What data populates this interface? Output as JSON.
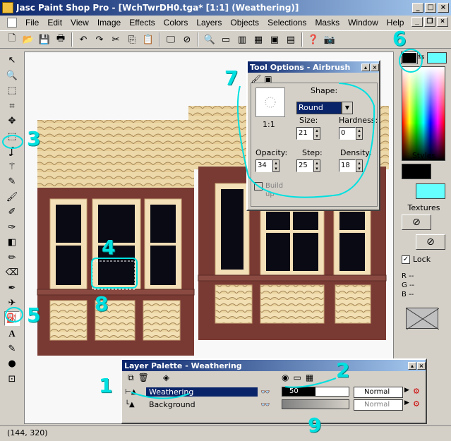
{
  "window": {
    "title": "Jasc Paint Shop Pro - [WchTwrDH0.tga* [1:1] (Weathering)]",
    "min": "_",
    "max": "□",
    "close": "×"
  },
  "menu": [
    "File",
    "Edit",
    "View",
    "Image",
    "Effects",
    "Colors",
    "Layers",
    "Objects",
    "Selections",
    "Masks",
    "Window",
    "Help"
  ],
  "toolbar_icons": [
    "new-icon",
    "open-icon",
    "save-icon",
    "print-icon",
    "undo-icon",
    "redo-icon",
    "cut-icon",
    "copy-icon",
    "paste-icon",
    "browse-icon",
    "delete-icon",
    "zoom-icon",
    "toolbar-icon",
    "histogram-icon",
    "palette-icon",
    "grid-icon",
    "help-icon",
    "camera-icon"
  ],
  "tools": [
    "arrow-icon",
    "zoom-icon",
    "deform-icon",
    "crop-icon",
    "mover-icon",
    "selection-icon",
    "freehand-select-icon",
    "magic-wand-icon",
    "dropper-icon",
    "paintbrush-icon",
    "clone-icon",
    "color-replacer-icon",
    "retouch-icon",
    "scratch-remover-icon",
    "eraser-icon",
    "picture-tube-icon",
    "airbrush-icon",
    "flood-fill-icon",
    "text-icon",
    "draw-icon",
    "preset-shapes-icon",
    "vector-object-icon"
  ],
  "tool_options": {
    "title": "Tool Options - Airbrush",
    "shape_label": "Shape:",
    "shape_value": "Round",
    "zoom_label": "1:1",
    "size_label": "Size:",
    "size_value": "21",
    "hardness_label": "Hardness:",
    "hardness_value": "0",
    "opacity_label": "Opacity:",
    "opacity_value": "34",
    "step_label": "Step:",
    "step_value": "25",
    "density_label": "Density:",
    "density_value": "18",
    "buildup_label": "Build up"
  },
  "color_palette": {
    "fg_color": "#000000",
    "bg_color": "#66ffff",
    "styles_label": "Styles",
    "textures_label": "Textures",
    "lock_label": "Lock",
    "r_label": "R",
    "g_label": "G",
    "b_label": "B",
    "r_val": "--",
    "g_val": "--",
    "b_val": "--"
  },
  "layer_palette": {
    "title": "Layer Palette - Weathering",
    "layers": [
      {
        "name": "Weathering",
        "opacity": "50",
        "opacity_level": 0.5,
        "blend": "Normal",
        "selected": true
      },
      {
        "name": "Background",
        "opacity": "",
        "opacity_level": 1.0,
        "blend": "Normal",
        "selected": false
      }
    ]
  },
  "status": {
    "coords": "(144, 320)"
  },
  "annotations": [
    "1",
    "2",
    "3",
    "4",
    "5",
    "6",
    "7",
    "8",
    "9"
  ],
  "accent": "#00e0e0"
}
